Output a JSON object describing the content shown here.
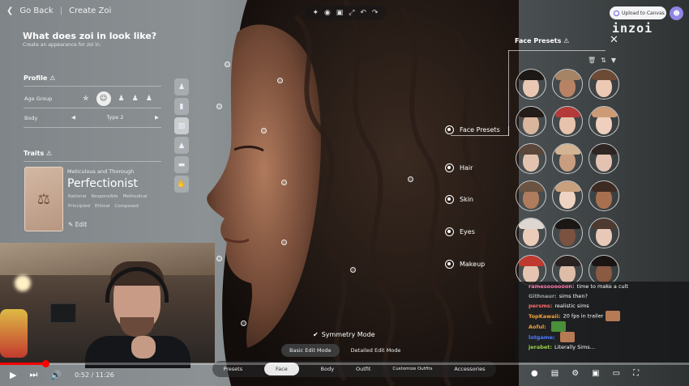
{
  "header": {
    "back_label": "Go Back",
    "title": "Create Zoi",
    "upload_label": "Upload to Canvas",
    "logo": "inzoi"
  },
  "toolbar_icons": [
    "spark-icon",
    "camera-icon",
    "focus-icon",
    "expand-icon",
    "undo-icon",
    "redo-icon"
  ],
  "panel": {
    "question": "What does zoi in look like?",
    "subtitle": "Create an appearance for zoi in.",
    "profile_title": "Profile",
    "age_group_label": "Age Group",
    "body_label": "Body",
    "body_value": "Type 2",
    "traits_title": "Traits",
    "trait_subtitle": "Meticulous and Thorough",
    "trait_name": "Perfectionist",
    "trait_tags_row1": [
      "Rational",
      "Responsible",
      "Methodical"
    ],
    "trait_tags_row2": [
      "Principled",
      "Ethical",
      "Composed"
    ],
    "edit_label": "Edit"
  },
  "categories": {
    "face_presets": "Face Presets",
    "hair": "Hair",
    "skin": "Skin",
    "eyes": "Eyes",
    "makeup": "Makeup"
  },
  "presets": {
    "title": "Face Presets",
    "faces": [
      {
        "skin": "#e9c7b2",
        "hair": "#1c1816"
      },
      {
        "skin": "#b88364",
        "hair": "#a58465"
      },
      {
        "skin": "#ecc9b5",
        "hair": "#6c4a36"
      },
      {
        "skin": "#d9b59d",
        "hair": "#241c18"
      },
      {
        "skin": "#e7c2ac",
        "hair": "#b43b3a"
      },
      {
        "skin": "#efcfbd",
        "hair": "#cd9a76"
      },
      {
        "skin": "#e3c3af",
        "hair": "#5b463a"
      },
      {
        "skin": "#c89d80",
        "hair": "#d2b493"
      },
      {
        "skin": "#e4c2b2",
        "hair": "#2f2523"
      },
      {
        "skin": "#b07c5d",
        "hair": "#6a5340"
      },
      {
        "skin": "#efd3c2",
        "hair": "#c9a07e"
      },
      {
        "skin": "#a9704f",
        "hair": "#3d2b21"
      },
      {
        "skin": "#ebccb9",
        "hair": "#ded6d0"
      },
      {
        "skin": "#7b5240",
        "hair": "#1b1714"
      },
      {
        "skin": "#e8c9b7",
        "hair": "#4d3a30"
      },
      {
        "skin": "#e6c4b1",
        "hair": "#c0392f"
      },
      {
        "skin": "#ddbca8",
        "hair": "#2a2220"
      },
      {
        "skin": "#8b5a42",
        "hair": "#1a1512"
      }
    ]
  },
  "bottom": {
    "symmetry_label": "Symmetry Mode",
    "basic_mode": "Basic Edit Mode",
    "detailed_mode": "Detailed Edit Mode",
    "tabs": [
      "Presets",
      "Face",
      "Body",
      "Outfit",
      "Customize Outfits",
      "Accessories"
    ]
  },
  "chat": [
    {
      "user": "ramesoooooon:",
      "text": "time to make a cult",
      "color": "#ff7ab0"
    },
    {
      "user": "Githnaur:",
      "text": "sims then?",
      "color": "#9aa0a6"
    },
    {
      "user": "persms:",
      "text": "realistic sims",
      "color": "#ff6b6b"
    },
    {
      "user": "TopKawaii:",
      "text": "20 fps in trailer",
      "color": "#f2a33a"
    },
    {
      "user": "Aoful:",
      "text": "",
      "color": "#f2a33a"
    },
    {
      "user": "lotgame:",
      "text": "",
      "color": "#4e7cff"
    },
    {
      "user": "jerabet:",
      "text": "Literally Sims...",
      "color": "#9ad04a"
    }
  ],
  "player": {
    "time": "0:52 / 11:26"
  }
}
